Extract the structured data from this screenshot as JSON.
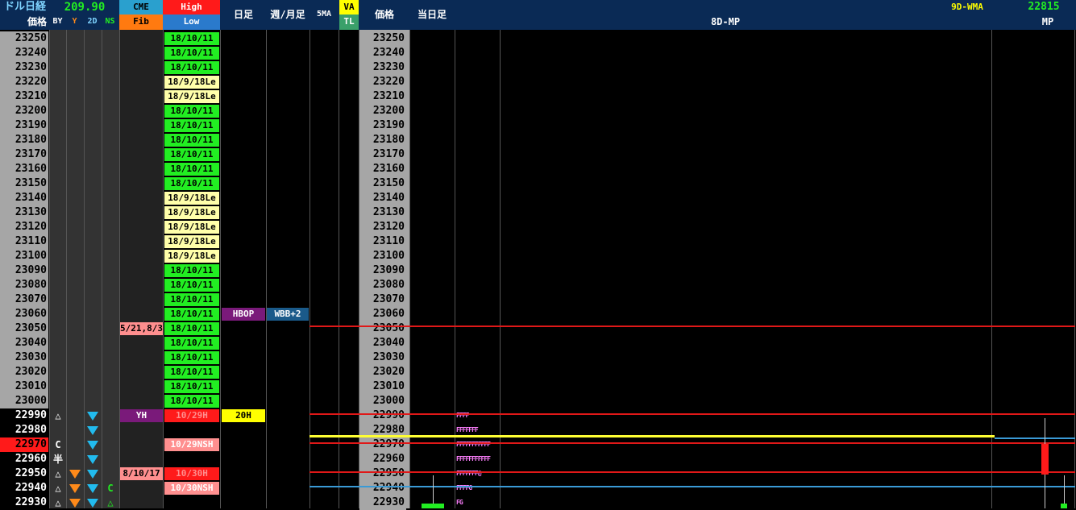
{
  "header": {
    "title": "ドル日経",
    "usdjpy_value": "209.90",
    "price_label": "価格",
    "by": "BY",
    "y": "Y",
    "twod": "2D",
    "ns": "NS",
    "cme": "CME",
    "fib": "Fib",
    "high": "High",
    "low": "Low",
    "daily": "日足",
    "weekly_monthly": "週/月足",
    "ma5": "5MA",
    "va": "VA",
    "tl": "TL",
    "price_label2": "価格",
    "today": "当日足",
    "wma": "9D-WMA",
    "wma_value": "22815",
    "mp8d": "8D-MP",
    "mp": "MP"
  },
  "prices": [
    "23250",
    "23240",
    "23230",
    "23220",
    "23210",
    "23200",
    "23190",
    "23180",
    "23170",
    "23160",
    "23150",
    "23140",
    "23130",
    "23120",
    "23110",
    "23100",
    "23090",
    "23080",
    "23070",
    "23060",
    "23050",
    "23040",
    "23030",
    "23020",
    "23010",
    "23000",
    "22990",
    "22980",
    "22970",
    "22960",
    "22950",
    "22940",
    "22930"
  ],
  "highlow": [
    "18/10/11",
    "18/10/11",
    "18/10/11",
    "18/9/18Le",
    "18/9/18Le",
    "18/10/11",
    "18/10/11",
    "18/10/11",
    "18/10/11",
    "18/10/11",
    "18/10/11",
    "18/9/18Le",
    "18/9/18Le",
    "18/9/18Le",
    "18/9/18Le",
    "18/9/18Le",
    "18/10/11",
    "18/10/11",
    "18/10/11",
    "18/10/11",
    "18/10/11",
    "18/10/11",
    "18/10/11",
    "18/10/11",
    "18/10/11",
    "18/10/11",
    "10/29H",
    "",
    "10/29NSH",
    "",
    "10/30H",
    "10/30NSH",
    ""
  ],
  "by_marks": {
    "26": "△",
    "28": "C",
    "29": "半",
    "30": "△",
    "31": "△",
    "32": "△"
  },
  "ns_marks": {
    "31": "C",
    "32": "△"
  },
  "cme_cells": {
    "20": "5/21,8/3",
    "26": "YH",
    "30": "8/10/17"
  },
  "daily_cells": {
    "19": "HBOP",
    "26": "20H"
  },
  "weekly_cells": {
    "19": "WBB+2"
  },
  "mp_rows": {
    "26": "FFFF",
    "27": "FFFFFFF",
    "28": "FFFFFFFFFFF",
    "29": "FFFFFFFFFFF",
    "30": "FFFFFFF@",
    "31": "FFFFG",
    "32": "FG"
  },
  "colors": {
    "green": "#22ee22",
    "yellow_light": "#ffffaa",
    "red": "#ff1a1a",
    "pink": "#ff8f8f",
    "purple": "#7a1a7a",
    "navy": "#0a2a55"
  }
}
